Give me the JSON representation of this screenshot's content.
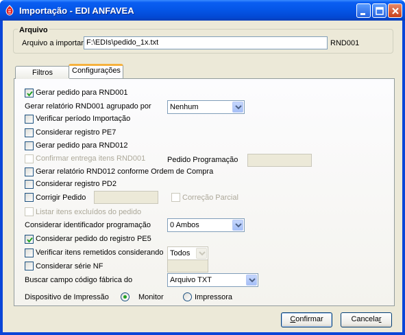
{
  "window": {
    "title": "Importação - EDI ANFAVEA",
    "icon": "edi-app-icon",
    "colors": {
      "titlebar": "#0455e6",
      "client": "#ece9d8",
      "tab_highlight": "#f6b23e",
      "check": "#21a121"
    }
  },
  "arquivo": {
    "legend": "Arquivo",
    "label": "Arquivo a importar",
    "value": "F:\\EDIs\\pedido_1x.txt",
    "format": "RND001"
  },
  "tabs": [
    {
      "label": "Filtros",
      "active": false
    },
    {
      "label": "Configurações",
      "active": true
    }
  ],
  "config": {
    "gerar_pedido_rnd001": {
      "label": "Gerar pedido para RND001",
      "checked": true
    },
    "gerar_relatorio_agrupado": {
      "label": "Gerar relatório RND001 agrupado por",
      "value": "Nenhum"
    },
    "verificar_periodo": {
      "label": "Verificar período Importação",
      "checked": false
    },
    "considerar_pe7": {
      "label": "Considerar registro PE7",
      "checked": false
    },
    "gerar_pedido_rnd012": {
      "label": "Gerar pedido para RND012",
      "checked": false
    },
    "confirmar_entrega": {
      "label": "Confirmar entrega itens RND001",
      "checked": false,
      "disabled": true
    },
    "pedido_programacao": {
      "label": "Pedido Programação",
      "value": ""
    },
    "gerar_relatorio_rnd012": {
      "label": "Gerar relatório RND012 conforme Ordem de Compra",
      "checked": false
    },
    "considerar_pd2": {
      "label": "Considerar registro PD2",
      "checked": false
    },
    "corrigir_pedido": {
      "label": "Corrigir Pedido",
      "checked": false,
      "value": ""
    },
    "correcao_parcial": {
      "label": "Correção Parcial",
      "checked": false,
      "disabled": true
    },
    "listar_excluidos": {
      "label": "Listar itens excluídos do pedido",
      "checked": false,
      "disabled": true
    },
    "identificador_programacao": {
      "label": "Considerar identificador programação",
      "value": "0 Ambos"
    },
    "considerar_pe5": {
      "label": "Considerar pedido do registro PE5",
      "checked": true
    },
    "verificar_remetidos": {
      "label": "Verificar itens remetidos considerando",
      "checked": false,
      "value": "Todos"
    },
    "considerar_serie_nf": {
      "label": "Considerar série NF",
      "checked": false,
      "value": ""
    },
    "buscar_campo": {
      "label": "Buscar campo código fábrica do",
      "value": "Arquivo TXT"
    },
    "dispositivo": {
      "label": "Dispositivo de Impressão",
      "options": [
        "Monitor",
        "Impressora"
      ],
      "selected": "Monitor"
    }
  },
  "buttons": {
    "confirmar_first": "C",
    "confirmar_rest": "onfirmar",
    "cancelar_first": "Cancela",
    "cancelar_u": "r"
  }
}
